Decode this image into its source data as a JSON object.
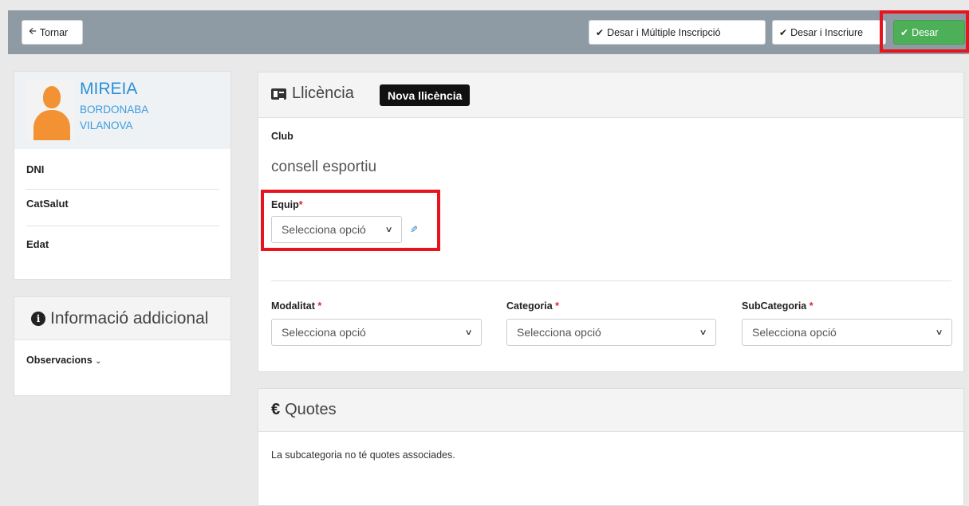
{
  "toolbar": {
    "back_label": "Tornar",
    "save_multi_label": "Desar i Múltiple Inscripció",
    "save_enroll_label": "Desar i Inscriure",
    "save_label": "Desar"
  },
  "profile": {
    "first_name": "MIREIA",
    "surname1": "BORDONABA",
    "surname2": "VILANOVA",
    "fields": [
      "DNI",
      "CatSalut",
      "Edat"
    ]
  },
  "info": {
    "title": "Informació addicional",
    "observations_label": "Observacions"
  },
  "license": {
    "title": "Llicència",
    "badge": "Nova llicència",
    "club_label": "Club",
    "club_value": "consell esportiu",
    "team_label": "Equip",
    "team_value": "Selecciona opció",
    "modality_label": "Modalitat",
    "modality_value": "Selecciona opció",
    "category_label": "Categoria",
    "category_value": "Selecciona opció",
    "subcategory_label": "SubCategoria",
    "subcategory_value": "Selecciona opció"
  },
  "quotes": {
    "symbol": "€",
    "title": "Quotes",
    "message": "La subcategoria no té quotes associades."
  },
  "colors": {
    "accent": "#2d8fd5",
    "save": "#4db058",
    "highlight": "#e8141d"
  }
}
